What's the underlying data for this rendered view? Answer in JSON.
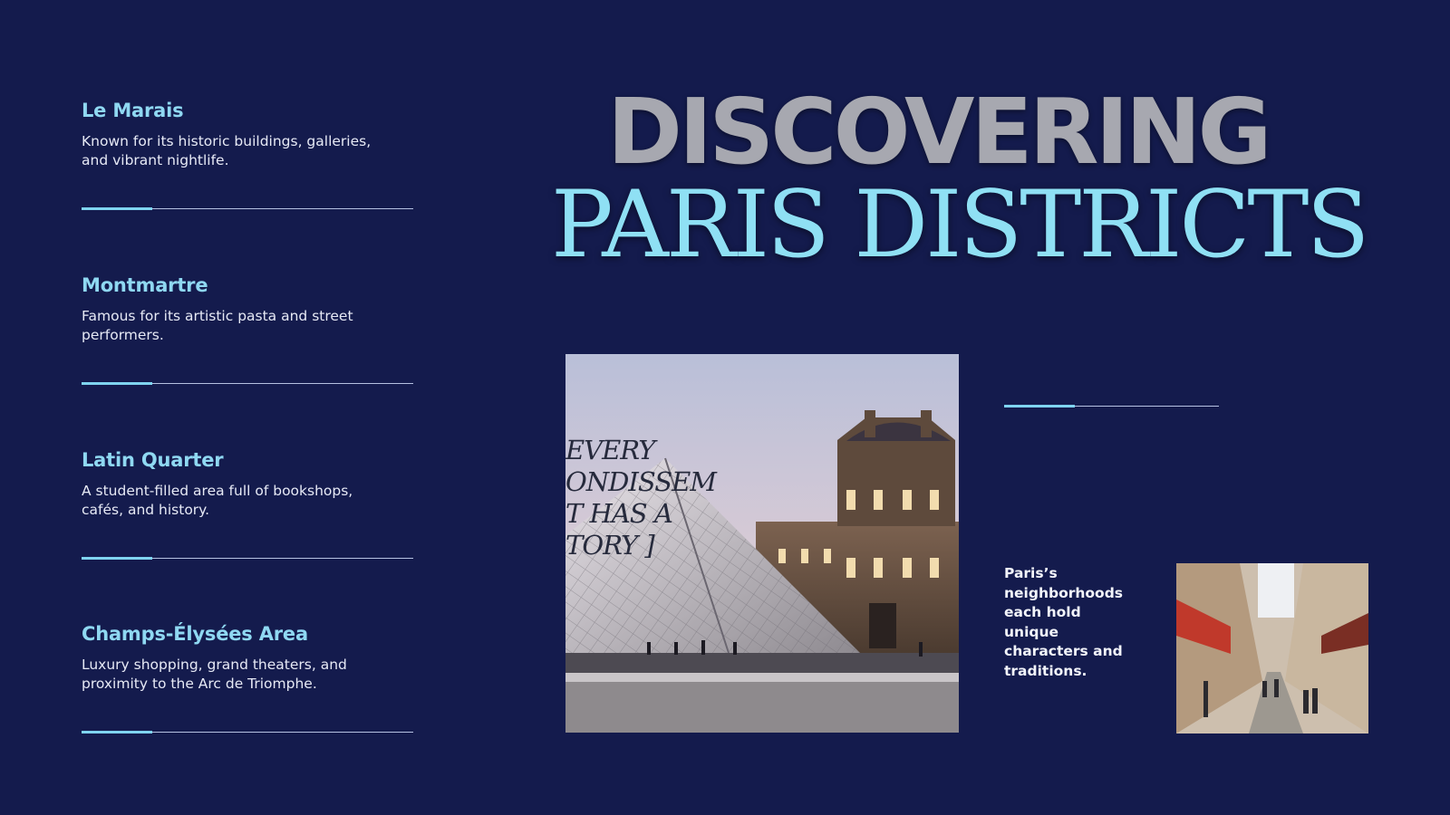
{
  "title": {
    "line1": "DISCOVERING",
    "line2": "PARIS DISTRICTS"
  },
  "districts": [
    {
      "name": "Le Marais",
      "description": "Known for its historic buildings, galleries, and vibrant nightlife."
    },
    {
      "name": "Montmartre",
      "description": "Famous for its artistic pasta and street performers."
    },
    {
      "name": "Latin Quarter",
      "description": "A student-filled area full of bookshops, cafés, and history."
    },
    {
      "name": "Champs-Élysées Area",
      "description": "Luxury shopping, grand theaters, and proximity to the Arc de Triomphe."
    }
  ],
  "photo_overlay_text": "EVERY\nONDISSEM\nT HAS A\nTORY ]",
  "side_text": "Paris’s neighborhoods each hold unique characters and traditions.",
  "colors": {
    "background": "#141b4d",
    "accent": "#7fd4f0",
    "heading": "#8fd8f2",
    "title_gray": "#a7a8b0"
  },
  "icons": {
    "main_photo": "louvre-pyramid-photo",
    "side_photo": "paris-street-photo"
  }
}
